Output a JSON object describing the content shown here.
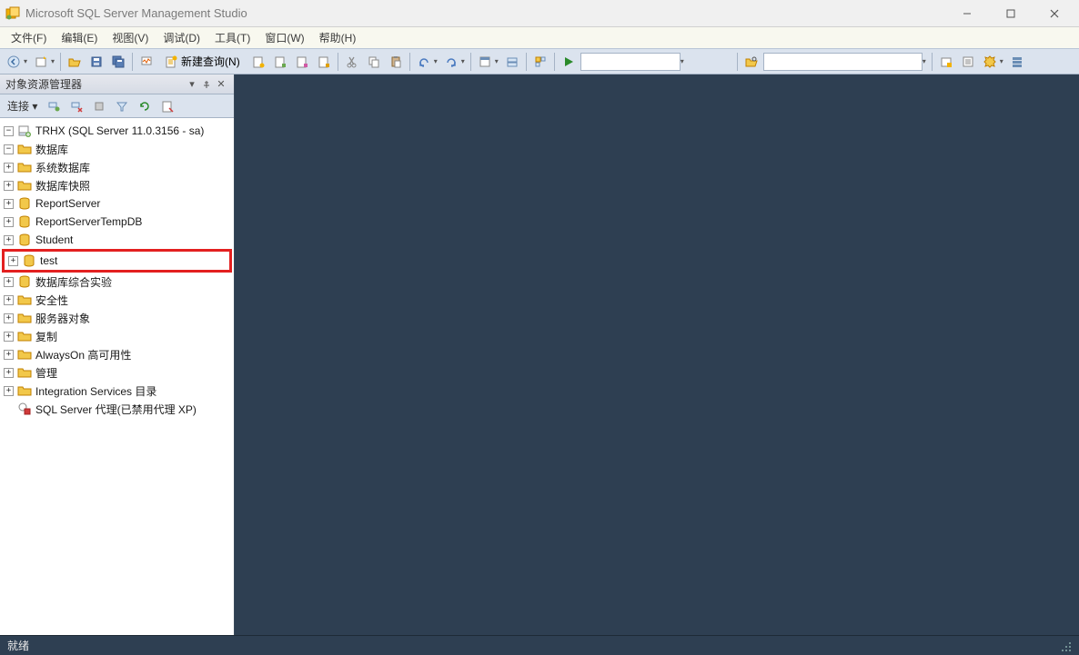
{
  "titlebar": {
    "title": "Microsoft SQL Server Management Studio"
  },
  "menubar": {
    "items": [
      "文件(F)",
      "编辑(E)",
      "视图(V)",
      "调试(D)",
      "工具(T)",
      "窗口(W)",
      "帮助(H)"
    ]
  },
  "toolbar": {
    "newquery_label": "新建查询(N)"
  },
  "panel": {
    "title": "对象资源管理器",
    "connect_label": "连接 ▾"
  },
  "tree": {
    "server": "TRHX (SQL Server 11.0.3156 - sa)",
    "databases": {
      "label": "数据库",
      "systemdb": "系统数据库",
      "snapshot": "数据库快照",
      "dbs": [
        "ReportServer",
        "ReportServerTempDB",
        "Student",
        "test",
        "数据库综合实验"
      ]
    },
    "security": "安全性",
    "serverobjects": "服务器对象",
    "replication": "复制",
    "alwayson": "AlwaysOn 高可用性",
    "management": "管理",
    "integration": "Integration Services 目录",
    "agent": "SQL Server 代理(已禁用代理 XP)"
  },
  "statusbar": {
    "ready": "就绪"
  }
}
